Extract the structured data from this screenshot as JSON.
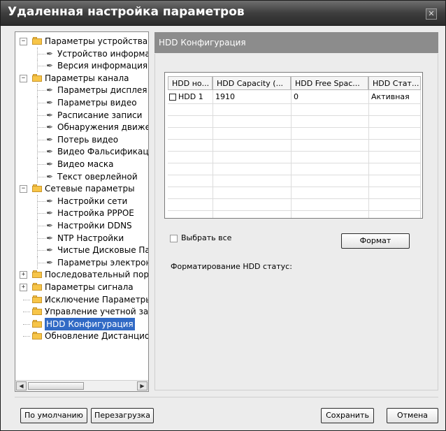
{
  "window": {
    "title": "Удаленная настройка параметров",
    "close_glyph": "✕"
  },
  "tree": [
    {
      "label": "Параметры устройства",
      "type": "folder",
      "level": 0,
      "expander": "−"
    },
    {
      "label": "Устройство информац",
      "type": "leaf",
      "level": 1
    },
    {
      "label": "Версия информация",
      "type": "leaf",
      "level": 1
    },
    {
      "label": "Параметры канала",
      "type": "folder",
      "level": 0,
      "expander": "−"
    },
    {
      "label": "Параметры дисплея",
      "type": "leaf",
      "level": 1
    },
    {
      "label": "Параметры видео",
      "type": "leaf",
      "level": 1
    },
    {
      "label": "Расписание записи",
      "type": "leaf",
      "level": 1
    },
    {
      "label": "Обнаружения движен",
      "type": "leaf",
      "level": 1
    },
    {
      "label": "Потерь видео",
      "type": "leaf",
      "level": 1
    },
    {
      "label": "Видео Фальсификаци",
      "type": "leaf",
      "level": 1
    },
    {
      "label": "Видео маска",
      "type": "leaf",
      "level": 1
    },
    {
      "label": "Текст оверлейной",
      "type": "leaf",
      "level": 1
    },
    {
      "label": "Сетевые параметры",
      "type": "folder",
      "level": 0,
      "expander": "−"
    },
    {
      "label": "Настройки сети",
      "type": "leaf",
      "level": 1
    },
    {
      "label": "Настройка PPPOE",
      "type": "leaf",
      "level": 1
    },
    {
      "label": "Настройки DDNS",
      "type": "leaf",
      "level": 1
    },
    {
      "label": "NTP Настройки",
      "type": "leaf",
      "level": 1
    },
    {
      "label": "Чистые Дисковые Пар",
      "type": "leaf",
      "level": 1
    },
    {
      "label": "Параметры электрони",
      "type": "leaf",
      "level": 1
    },
    {
      "label": "Последовательный порт",
      "type": "folder",
      "level": 0,
      "expander": "+"
    },
    {
      "label": "Параметры сигнала",
      "type": "folder",
      "level": 0,
      "expander": "+"
    },
    {
      "label": "Исключение Параметры",
      "type": "folder",
      "level": 0
    },
    {
      "label": "Управление учетной запи",
      "type": "folder",
      "level": 0
    },
    {
      "label": "HDD Конфигурация",
      "type": "folder",
      "level": 0,
      "selected": true
    },
    {
      "label": "Обновление Дистанцион",
      "type": "folder",
      "level": 0
    }
  ],
  "content": {
    "header": "HDD Конфигурация",
    "table": {
      "columns": [
        "HDD но...",
        "HDD Capacity (...",
        "HDD Free Spac...",
        "HDD Стат..."
      ],
      "rows": [
        {
          "number": "HDD 1",
          "capacity": "1910",
          "free": "0",
          "status": "Активная"
        }
      ]
    },
    "select_all": "Выбрать все",
    "format_button": "Формат",
    "format_status": "Форматирование HDD статус:"
  },
  "footer": {
    "default_button": "По умолчанию",
    "reboot_button": "Перезагрузка",
    "save_button": "Сохранить",
    "cancel_button": "Отмена"
  },
  "icons": {
    "folder": "folder-icon",
    "leaf": "wrench-icon"
  },
  "colors": {
    "titlebar": "#3e3e3e",
    "selection": "#316ac5",
    "header": "#8c8c8c",
    "folder": "#f7c548"
  }
}
